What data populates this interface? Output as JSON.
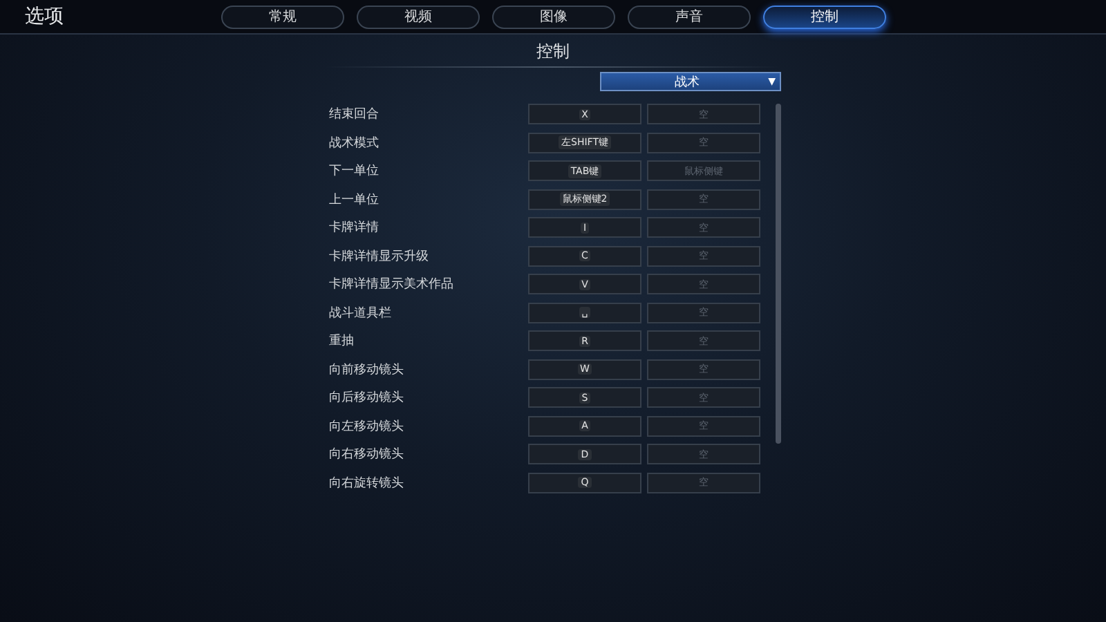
{
  "window": {
    "title": "选项"
  },
  "tabs": [
    {
      "label": "常规",
      "selected": false
    },
    {
      "label": "视频",
      "selected": false
    },
    {
      "label": "图像",
      "selected": false
    },
    {
      "label": "声音",
      "selected": false
    },
    {
      "label": "控制",
      "selected": true
    }
  ],
  "section": {
    "title": "控制"
  },
  "dropdown": {
    "value": "战术",
    "caret": "▼"
  },
  "bindings": [
    {
      "action": "结束回合",
      "primary": "X",
      "secondary": "空"
    },
    {
      "action": "战术模式",
      "primary": "左SHIFT键",
      "secondary": "空"
    },
    {
      "action": "下一单位",
      "primary": "TAB键",
      "secondary": "鼠标侧键"
    },
    {
      "action": "上一单位",
      "primary": "鼠标侧键2",
      "secondary": "空"
    },
    {
      "action": "卡牌详情",
      "primary": "I",
      "secondary": "空"
    },
    {
      "action": "卡牌详情显示升级",
      "primary": "C",
      "secondary": "空"
    },
    {
      "action": "卡牌详情显示美术作品",
      "primary": "V",
      "secondary": "空"
    },
    {
      "action": "战斗道具栏",
      "primary": "␣",
      "secondary": "空"
    },
    {
      "action": "重抽",
      "primary": "R",
      "secondary": "空"
    },
    {
      "action": "向前移动镜头",
      "primary": "W",
      "secondary": "空"
    },
    {
      "action": "向后移动镜头",
      "primary": "S",
      "secondary": "空"
    },
    {
      "action": "向左移动镜头",
      "primary": "A",
      "secondary": "空"
    },
    {
      "action": "向右移动镜头",
      "primary": "D",
      "secondary": "空"
    },
    {
      "action": "向右旋转镜头",
      "primary": "Q",
      "secondary": "空"
    }
  ]
}
